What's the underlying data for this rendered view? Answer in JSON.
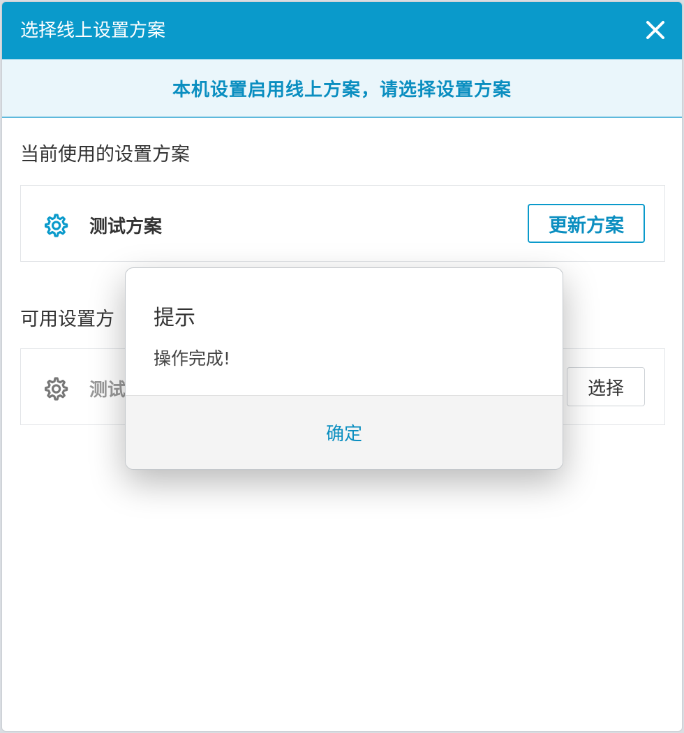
{
  "window": {
    "title": "选择线上设置方案",
    "close_icon": "close-icon"
  },
  "banner": {
    "text": "本机设置启用线上方案，请选择设置方案"
  },
  "current": {
    "section_title": "当前使用的设置方案",
    "plan_name": "测试方案",
    "update_label": "更新方案"
  },
  "available": {
    "section_title": "可用设置方",
    "plan_name": "测试",
    "select_label": "选择"
  },
  "modal": {
    "title": "提示",
    "message": "操作完成!",
    "ok_label": "确定"
  },
  "colors": {
    "accent": "#0a9acb",
    "accent_text": "#0a8ec0",
    "banner_bg": "#eaf6fb"
  }
}
